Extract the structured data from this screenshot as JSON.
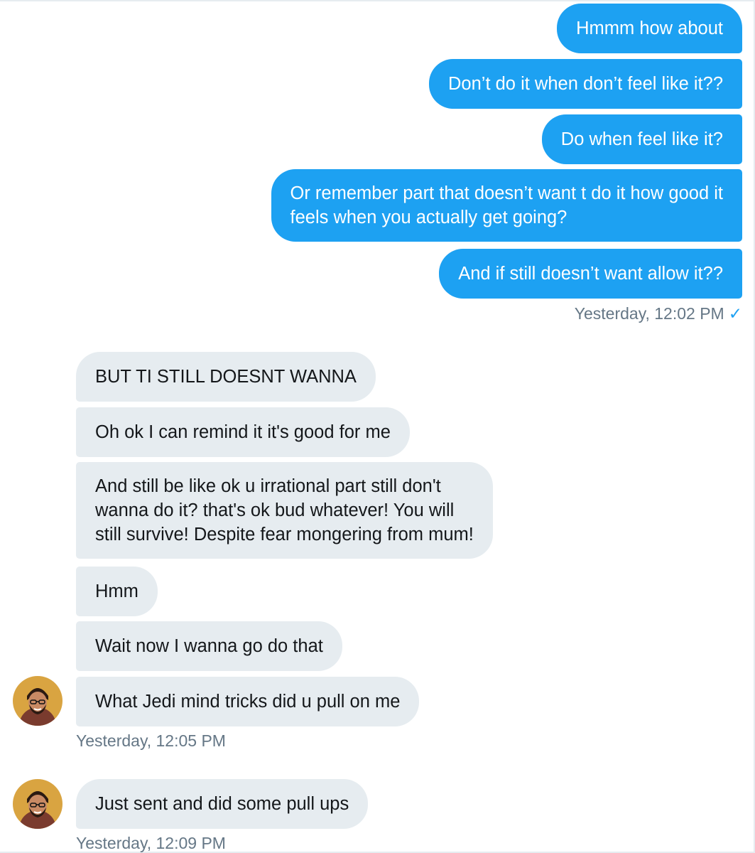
{
  "outgoing": [
    {
      "text": "Hmmm how about"
    },
    {
      "text": "Don’t do it when don’t feel like it??"
    },
    {
      "text": "Do when feel like it?"
    },
    {
      "lines": [
        "Or remember part that doesn’t want t do it how good it",
        "feels when you actually get going?"
      ]
    },
    {
      "text": "And if still doesn’t want allow it??"
    }
  ],
  "outgoing_timestamp": "Yesterday, 12:02 PM",
  "outgoing_status_icon": "checkmark-icon",
  "incoming": [
    {
      "text": "BUT TI STILL DOESNT WANNA"
    },
    {
      "text": "Oh ok I can remind it it's good for me"
    },
    {
      "lines": [
        "And still be like ok u irrational  part still don't",
        "wanna do it? that's ok bud whatever! You will",
        "still survive! Despite fear mongering from mum!"
      ]
    },
    {
      "text": "Hmm"
    },
    {
      "text": "Wait now I wanna go do that"
    },
    {
      "text": "What Jedi mind tricks did u pull on me"
    }
  ],
  "incoming_timestamp_1": "Yesterday, 12:05 PM",
  "incoming_2": [
    {
      "text": "Just sent and did some pull ups"
    }
  ],
  "incoming_timestamp_2": "Yesterday, 12:09 PM",
  "colors": {
    "outgoing_bubble": "#1da1f2",
    "incoming_bubble": "#e6ecf0",
    "timestamp": "#657786"
  }
}
